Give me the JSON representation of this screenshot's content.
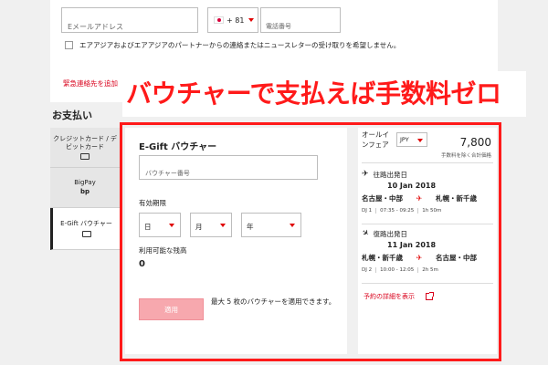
{
  "contact": {
    "email_label": "Eメールアドレス",
    "country_code": "+ 81",
    "phone_label": "電話番号",
    "newsletter_text": "エアアジアおよびエアアジアのパートナーからの連絡またはニュースレターの受け取りを希望しません。",
    "emergency_link": "緊急連絡先を追加"
  },
  "promo_banner": "バウチャーで支払えば手数料ゼロ",
  "payment": {
    "title": "お支払い",
    "methods": [
      {
        "label": "クレジットカード / デビットカード",
        "icon": "credit-card-icon"
      },
      {
        "label": "BigPay",
        "icon": "bigpay-icon"
      },
      {
        "label": "E-Gift バウチャー",
        "icon": "gift-icon",
        "active": true
      }
    ]
  },
  "voucher": {
    "title": "E-Gift バウチャー",
    "number_placeholder": "バウチャー番号",
    "expiry_label": "有効期限",
    "day_label": "日",
    "month_label": "月",
    "year_label": "年",
    "balance_label": "利用可能な残高",
    "balance_value": "0",
    "apply_button": "適用",
    "apply_note": "最大 5 枚のバウチャーを適用できます。"
  },
  "summary": {
    "fare_label": "オールインフェア",
    "currency": "JPY",
    "amount": "7,800",
    "fare_note": "手数料を除く合計価格",
    "flights": [
      {
        "direction": "往路出発日",
        "date": "10 Jan 2018",
        "from": "名古屋・中部",
        "to": "札幌・新千歳",
        "flight_no": "DJ 1",
        "time": "07:35 - 09:25",
        "duration": "1h 50m"
      },
      {
        "direction": "復路出発日",
        "date": "11 Jan 2018",
        "from": "札幌・新千歳",
        "to": "名古屋・中部",
        "flight_no": "DJ 2",
        "time": "10:00 - 12:05",
        "duration": "2h 5m"
      }
    ],
    "details_link": "予約の詳細を表示"
  },
  "colors": {
    "accent_red": "#ff1a1a",
    "link_red": "#d9001b",
    "apply_disabled": "#f7a8ae"
  }
}
